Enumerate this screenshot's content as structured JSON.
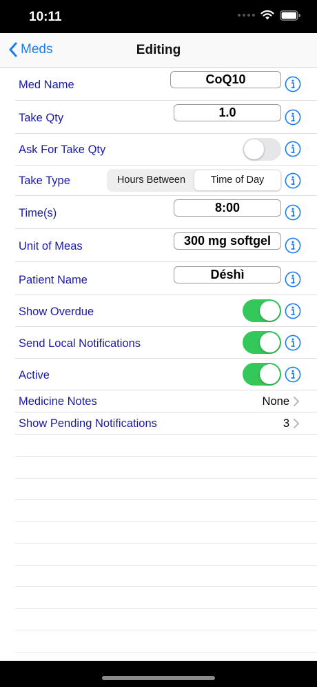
{
  "status_bar": {
    "time": "10:11"
  },
  "nav": {
    "back_label": "Meds",
    "title": "Editing"
  },
  "fields": {
    "med_name": {
      "label": "Med Name",
      "value": "CoQ10"
    },
    "take_qty": {
      "label": "Take Qty",
      "value": "1.0"
    },
    "ask_for_take_qty": {
      "label": "Ask For Take Qty",
      "on": false
    },
    "take_type": {
      "label": "Take Type",
      "options": [
        "Hours Between",
        "Time of Day"
      ],
      "selected": "Time of Day"
    },
    "times": {
      "label": "Time(s)",
      "value": "8:00"
    },
    "unit_of_meas": {
      "label": "Unit of Meas",
      "value": "300 mg softgel"
    },
    "patient_name": {
      "label": "Patient Name",
      "value": "Déshì"
    },
    "show_overdue": {
      "label": "Show Overdue",
      "on": true
    },
    "send_local_notifications": {
      "label": "Send Local Notifications",
      "on": true
    },
    "active": {
      "label": "Active",
      "on": true
    },
    "medicine_notes": {
      "label": "Medicine Notes",
      "value": "None"
    },
    "show_pending_notifications": {
      "label": "Show Pending Notifications",
      "value": "3"
    }
  },
  "colors": {
    "accent": "#1a7cf2",
    "label": "#1a1aa6",
    "toggle_on": "#34c759"
  }
}
